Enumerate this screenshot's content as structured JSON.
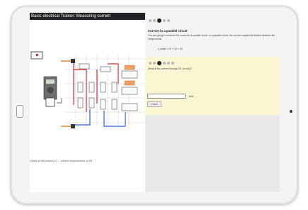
{
  "window": {
    "title": "Basic electrical Trainer: Measuring current"
  },
  "section": {
    "title": "Current in a parallel circuit",
    "intro": "You are going to measure the current in a parallel circuit. In a parallel circuit, the current supplied is divided between the components.",
    "formula": "I_total = I1 + I2 + I3"
  },
  "question": {
    "text": "What is the current through R1 (in mA)?",
    "answer_value": "",
    "unit": "mA",
    "check_label": "Check"
  },
  "circuit": {
    "caption": "Circuit on the board in 2 — current measurement on R1"
  },
  "colors": {
    "titlebar": "#202124",
    "task_bg": "#fbf6d2",
    "wire_red": "#d62828",
    "wire_blue": "#2b5fd9",
    "accent_orange": "#f0a060"
  }
}
